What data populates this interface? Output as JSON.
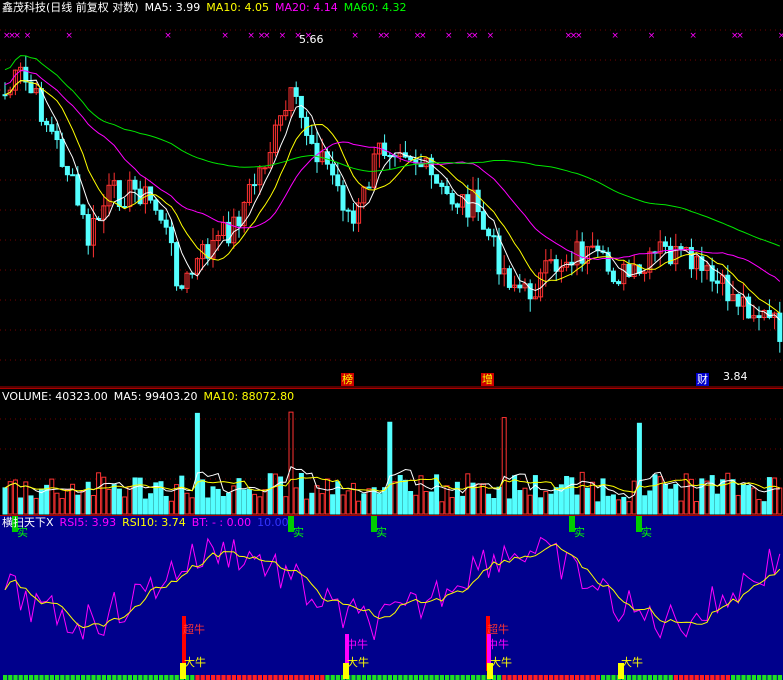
{
  "price_header": {
    "name": "鑫茂科技(日线 前复权 对数)",
    "ma5": "MA5: 3.99",
    "ma10": "MA10: 4.05",
    "ma20": "MA20: 4.14",
    "ma60": "MA60: 4.32"
  },
  "price_labels": {
    "high": "5.66",
    "low": "3.84",
    "tag1": "榜",
    "tag2": "增",
    "tag3": "财"
  },
  "volume_header": {
    "name": "VOLUME: 40323.00",
    "ma5": "MA5: 99403.20",
    "ma10": "MA10: 88072.80"
  },
  "indicator_header": {
    "name": "横扫天下X",
    "rsi5": "RSI5: 3.93",
    "rsi10": "RSI10: 3.74",
    "bt": "BT: - : 0.00",
    "v10": "10.00"
  },
  "indicator_labels": {
    "shi": "实",
    "chao_niu": "超牛",
    "zhong_niu": "中牛",
    "da_niu": "大牛"
  },
  "colors": {
    "up": "#ff3232",
    "down": "#54ffff",
    "ma5": "#ffffff",
    "ma10": "#ffff00",
    "ma20": "#ff00ff",
    "ma60": "#00e600",
    "rsi5": "#ff00ff",
    "rsi10": "#ffff00",
    "panel": "#00008c"
  },
  "chart_data": {
    "type": "candlestick",
    "series": [
      "MA5",
      "MA10",
      "MA20",
      "MA60"
    ],
    "price_high": 5.66,
    "price_low": 3.84,
    "ma5": 3.99,
    "ma10": 4.05,
    "ma20": 4.14,
    "ma60": 4.32,
    "volume_last": 40323.0,
    "vol_ma5": 99403.2,
    "vol_ma10": 88072.8,
    "rsi5": 3.93,
    "rsi10": 3.74
  }
}
